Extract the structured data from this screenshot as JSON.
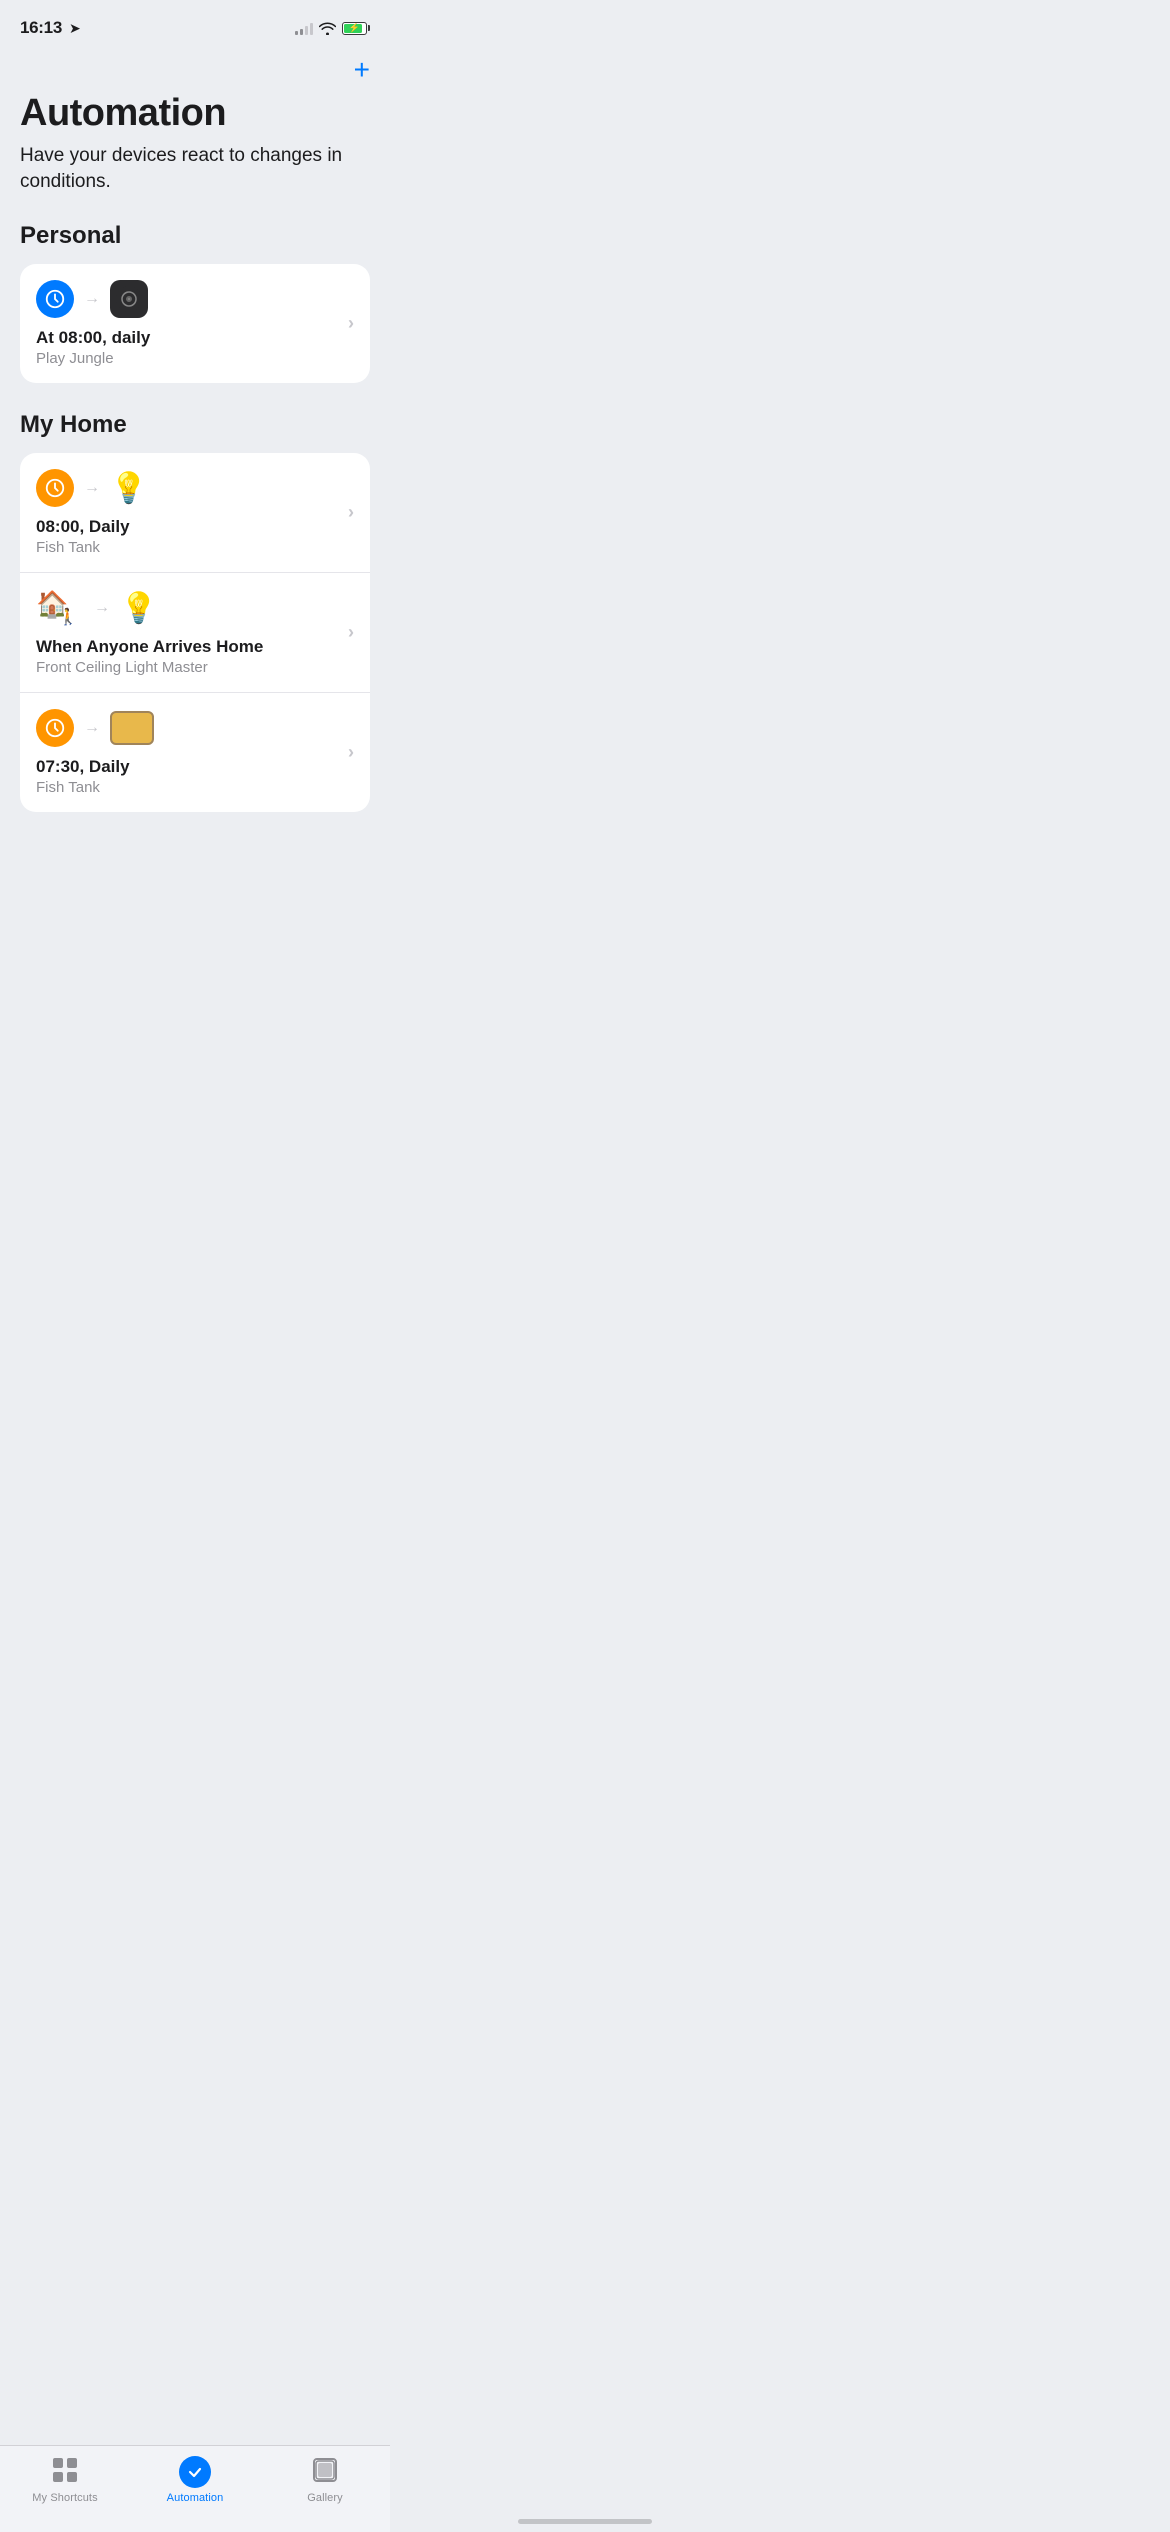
{
  "statusBar": {
    "time": "16:13",
    "hasLocation": true
  },
  "header": {
    "addButtonLabel": "+",
    "title": "Automation",
    "subtitle": "Have your devices react to changes in conditions."
  },
  "sections": [
    {
      "id": "personal",
      "title": "Personal",
      "automations": [
        {
          "id": "personal-1",
          "triggerType": "time",
          "triggerColor": "blue",
          "triggerEmoji": "🕐",
          "actionType": "speaker",
          "title": "At 08:00, daily",
          "subtitle": "Play Jungle"
        }
      ]
    },
    {
      "id": "my-home",
      "title": "My Home",
      "automations": [
        {
          "id": "home-1",
          "triggerType": "time",
          "triggerColor": "orange",
          "triggerEmoji": "🕐",
          "actionType": "bulb",
          "title": "08:00, Daily",
          "subtitle": "Fish Tank"
        },
        {
          "id": "home-2",
          "triggerType": "arrive",
          "triggerColor": "orange",
          "actionType": "bulb",
          "title": "When Anyone Arrives Home",
          "subtitle": "Front Ceiling Light Master"
        },
        {
          "id": "home-3",
          "triggerType": "time",
          "triggerColor": "orange",
          "triggerEmoji": "🕐",
          "actionType": "screen",
          "title": "07:30, Daily",
          "subtitle": "Fish Tank"
        }
      ]
    }
  ],
  "bottomNav": {
    "items": [
      {
        "id": "my-shortcuts",
        "label": "My Shortcuts",
        "icon": "grid",
        "active": false
      },
      {
        "id": "automation",
        "label": "Automation",
        "icon": "check-circle",
        "active": true
      },
      {
        "id": "gallery",
        "label": "Gallery",
        "icon": "layers",
        "active": false
      }
    ]
  }
}
